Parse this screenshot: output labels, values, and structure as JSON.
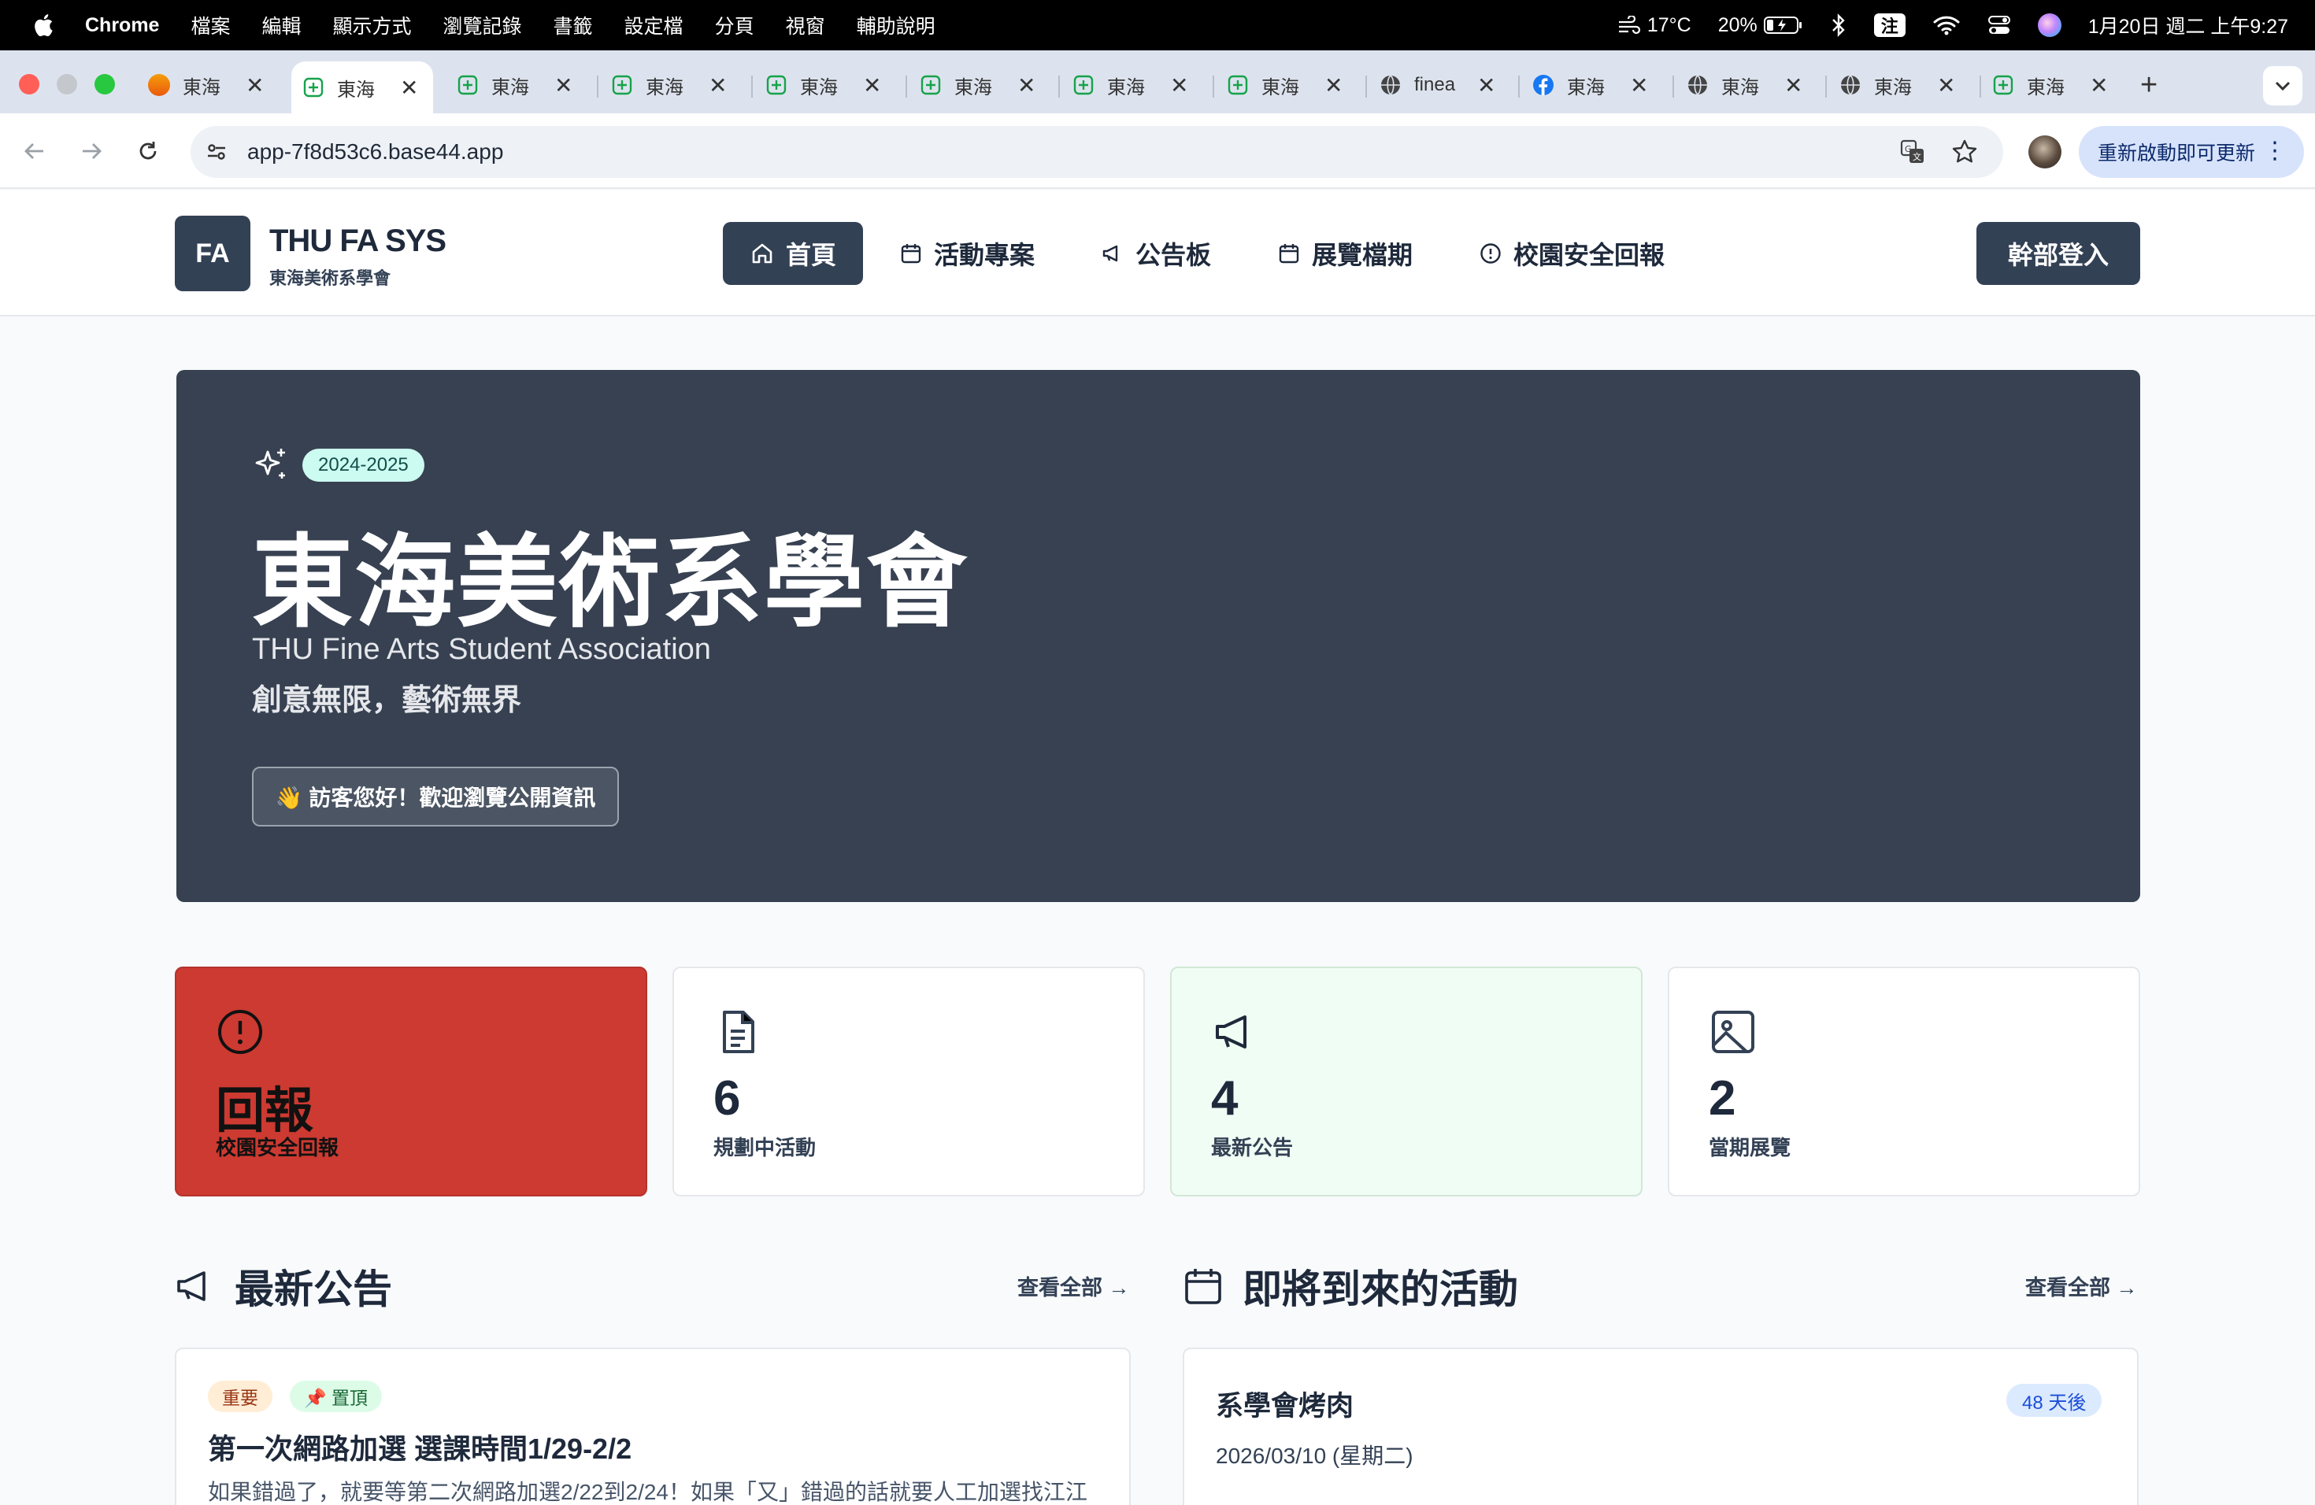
{
  "menubar": {
    "app": "Chrome",
    "items": [
      "檔案",
      "編輯",
      "顯示方式",
      "瀏覽記錄",
      "書籤",
      "設定檔",
      "分頁",
      "視窗",
      "輔助說明"
    ],
    "weather": "17°C",
    "battery": "20%",
    "ime": "注",
    "datetime": "1月20日 週二 上午9:27"
  },
  "tabs": [
    {
      "label": "東海",
      "icon": "orange-circle-icon"
    },
    {
      "label": "東海",
      "icon": "base44-icon",
      "active": true
    },
    {
      "label": "東海",
      "icon": "base44-icon"
    },
    {
      "label": "東海",
      "icon": "base44-icon"
    },
    {
      "label": "東海",
      "icon": "base44-icon"
    },
    {
      "label": "東海",
      "icon": "base44-icon"
    },
    {
      "label": "東海",
      "icon": "base44-icon"
    },
    {
      "label": "東海",
      "icon": "base44-icon"
    },
    {
      "label": "finea",
      "icon": "globe-icon"
    },
    {
      "label": "東海",
      "icon": "facebook-icon"
    },
    {
      "label": "東海",
      "icon": "globe-icon"
    },
    {
      "label": "東海",
      "icon": "globe-icon"
    },
    {
      "label": "東海",
      "icon": "base44-icon"
    }
  ],
  "address": {
    "url": "app-7f8d53c6.base44.app",
    "relaunch": "重新啟動即可更新"
  },
  "site": {
    "logo": "FA",
    "name": "THU FA SYS",
    "subtitle": "東海美術系學會",
    "nav": [
      {
        "label": "首頁",
        "icon": "home-icon"
      },
      {
        "label": "活動專案",
        "icon": "calendar-icon"
      },
      {
        "label": "公告板",
        "icon": "megaphone-icon"
      },
      {
        "label": "展覽檔期",
        "icon": "calendar-icon"
      },
      {
        "label": "校園安全回報",
        "icon": "alert-circle-icon"
      }
    ],
    "login": "幹部登入"
  },
  "hero": {
    "year": "2024-2025",
    "title": "東海美術系學會",
    "subtitle_en": "THU Fine Arts Student Association",
    "slogan": "創意無限，藝術無界",
    "greeting": "👋 訪客您好！歡迎瀏覽公開資訊"
  },
  "stats": [
    {
      "value": "回報",
      "label": "校園安全回報",
      "icon": "alert-circle-icon",
      "color": "#cc3a31"
    },
    {
      "value": "6",
      "label": "規劃中活動",
      "icon": "document-icon"
    },
    {
      "value": "4",
      "label": "最新公告",
      "icon": "megaphone-icon",
      "color": "#f0fdf4"
    },
    {
      "value": "2",
      "label": "當期展覽",
      "icon": "image-icon"
    }
  ],
  "announcements": {
    "title": "最新公告",
    "more": "查看全部 →",
    "items": [
      {
        "tags": [
          "重要",
          "📌 置頂"
        ],
        "title": "第一次網路加選 選課時間1/29-2/2",
        "body": "如果錯過了，就要等第二次網路加選2/22到2/24！如果「又」錯過的話就要人工加選找江江"
      }
    ]
  },
  "events": {
    "title": "即將到來的活動",
    "more": "查看全部 →",
    "items": [
      {
        "title": "系學會烤肉",
        "date": "2026/03/10 (星期二)",
        "countdown": "48 天後"
      }
    ]
  }
}
